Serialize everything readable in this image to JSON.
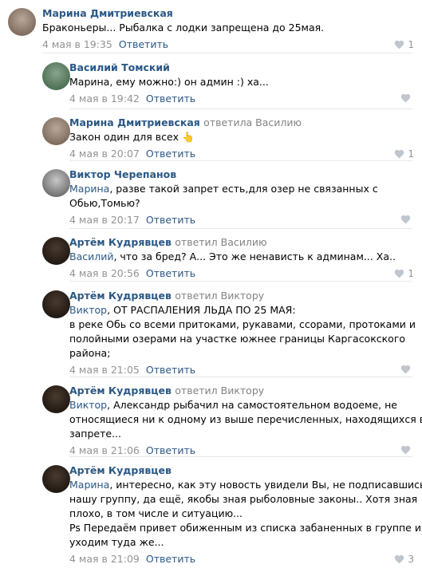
{
  "reply_action": "Ответить",
  "comments": [
    {
      "author": "Марина Дмитриевская",
      "replied": "",
      "lines": [
        [
          {
            "t": "Браконьеры... Рыбалка с лодки запрещена до 25мая."
          }
        ]
      ],
      "date": "4 мая в 19:35",
      "likes": "1"
    },
    {
      "author": "Василий Томский",
      "replied": "",
      "lines": [
        [
          {
            "t": "Марина, ему можно:) он админ :) ха..."
          }
        ]
      ],
      "date": "4 мая в 19:42",
      "likes": ""
    },
    {
      "author": "Марина Дмитриевская",
      "replied": "ответила Василию",
      "lines": [
        [
          {
            "t": "Закон один для всех 👆"
          }
        ]
      ],
      "date": "4 мая в 20:07",
      "likes": "1"
    },
    {
      "author": "Виктор Черепанов",
      "replied": "",
      "lines": [
        [
          {
            "t": "Марина",
            "m": true
          },
          {
            "t": ", разве такой запрет есть,для озер не связанных с"
          }
        ],
        [
          {
            "t": "Обью,Томью?"
          }
        ]
      ],
      "date": "4 мая в 20:17",
      "likes": ""
    },
    {
      "author": "Артём Кудрявцев",
      "replied": "ответил Василию",
      "lines": [
        [
          {
            "t": "Василий",
            "m": true
          },
          {
            "t": ", что за бред? А... Это же ненависть к админам... Ха.."
          }
        ]
      ],
      "date": "4 мая в 20:56",
      "likes": "1"
    },
    {
      "author": "Артём Кудрявцев",
      "replied": "ответил Виктору",
      "lines": [
        [
          {
            "t": "Виктор",
            "m": true
          },
          {
            "t": ", ОТ РАСПАЛЕНИЯ ЛЬДА ПО 25 МАЯ:"
          }
        ],
        [
          {
            "t": "в реке Обь со всеми притоками, рукавами, ссорами, протоками и"
          }
        ],
        [
          {
            "t": "полойными озерами на участке южнее границы Каргасокского"
          }
        ],
        [
          {
            "t": "района;"
          }
        ]
      ],
      "date": "4 мая в 21:05",
      "likes": ""
    },
    {
      "author": "Артём Кудрявцев",
      "replied": "ответил Виктору",
      "lines": [
        [
          {
            "t": "Виктор",
            "m": true
          },
          {
            "t": ", Александр рыбачил на самостоятельном водоеме, не"
          }
        ],
        [
          {
            "t": "относящиеся ни к одному из выше перечисленных, находящихся в"
          }
        ],
        [
          {
            "t": "запрете..."
          }
        ]
      ],
      "date": "4 мая в 21:06",
      "likes": ""
    },
    {
      "author": "Артём Кудрявцев",
      "replied": "",
      "lines": [
        [
          {
            "t": "Марина",
            "m": true
          },
          {
            "t": ", интересно, как эту новость увидели Вы, не подписавшись на"
          }
        ],
        [
          {
            "t": "нашу группу, да ещё, якобы зная рыболовные законы.. Хотя зная"
          }
        ],
        [
          {
            "t": "плохо, в том числе и ситуацию..."
          }
        ],
        [
          {
            "t": "Ps Передаём привет обиженным из списка забаненных в группе и"
          }
        ],
        [
          {
            "t": "уходим туда же..."
          }
        ]
      ],
      "date": "4 мая в 21:09",
      "likes": "3"
    }
  ]
}
